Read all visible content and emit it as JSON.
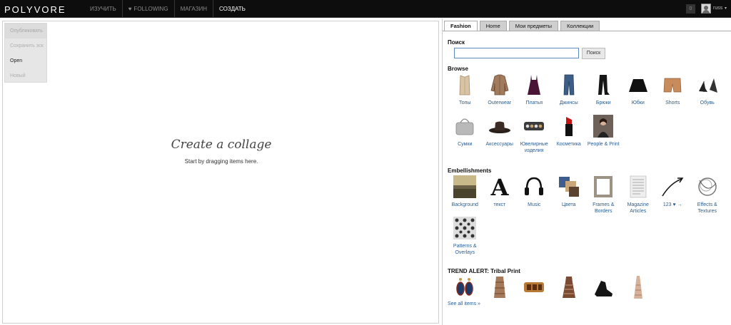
{
  "brand": {
    "logo": "POLYVORE"
  },
  "nav": {
    "items": [
      {
        "label": "ИЗУЧИТЬ"
      },
      {
        "label": "FOLLOWING"
      },
      {
        "label": "МАГАЗИН"
      },
      {
        "label": "СОЗДАТЬ"
      }
    ]
  },
  "user": {
    "notifications": "0",
    "name": "russ",
    "caret": "▾"
  },
  "canvas": {
    "menu": [
      "Опубликовать",
      "Сохранить эск",
      "Open",
      "Новый"
    ],
    "title": "Create a collage",
    "subtitle": "Start by dragging items here."
  },
  "panel": {
    "tabs": [
      "Fashion",
      "Home",
      "Мои предметы",
      "Коллекции"
    ],
    "search": {
      "label": "Поиск",
      "value": "",
      "button": "Поиск"
    },
    "browse": {
      "title": "Browse",
      "items": [
        {
          "label": "Топы",
          "icon": "top-icon"
        },
        {
          "label": "Outerwear",
          "icon": "jacket-icon"
        },
        {
          "label": "Платья",
          "icon": "dress-icon"
        },
        {
          "label": "Джинсы",
          "icon": "jeans-icon"
        },
        {
          "label": "Брюки",
          "icon": "pants-icon"
        },
        {
          "label": "Юбки",
          "icon": "skirt-icon"
        },
        {
          "label": "Shorts",
          "icon": "shorts-icon"
        },
        {
          "label": "Обувь",
          "icon": "shoes-icon"
        },
        {
          "label": "Сумки",
          "icon": "bag-icon"
        },
        {
          "label": "Аксессуары",
          "icon": "hat-icon"
        },
        {
          "label": "Ювелирные изделия",
          "icon": "bracelet-icon"
        },
        {
          "label": "Косметика",
          "icon": "lipstick-icon"
        },
        {
          "label": "People & Print",
          "icon": "person-icon"
        }
      ]
    },
    "embellishments": {
      "title": "Embellishments",
      "items": [
        {
          "label": "Background",
          "icon": "background-icon"
        },
        {
          "label": "текст",
          "icon": "letter-a-icon"
        },
        {
          "label": "Music",
          "icon": "headphones-icon"
        },
        {
          "label": "Цвета",
          "icon": "swatches-icon"
        },
        {
          "label": "Frames & Borders",
          "icon": "frame-icon"
        },
        {
          "label": "Magazine Articles",
          "icon": "magazine-icon"
        },
        {
          "label": "123 ♥ →",
          "icon": "arrow-icon"
        },
        {
          "label": "Effects & Textures",
          "icon": "effects-icon"
        },
        {
          "label": "Patterns & Overlays",
          "icon": "pattern-icon"
        }
      ]
    },
    "trend": {
      "title": "TREND ALERT: Tribal Print",
      "see_all": "See all items »",
      "items": [
        "earrings-icon",
        "tribal-skirt-icon",
        "cuff-icon",
        "tribal-dress-icon",
        "sandal-icon",
        "maxi-dress-icon"
      ]
    }
  },
  "colors": {
    "link": "#2a5d93",
    "topbar": "#0d0d0d",
    "tab_active": "#ffffff",
    "tab": "#cfcfcf"
  }
}
